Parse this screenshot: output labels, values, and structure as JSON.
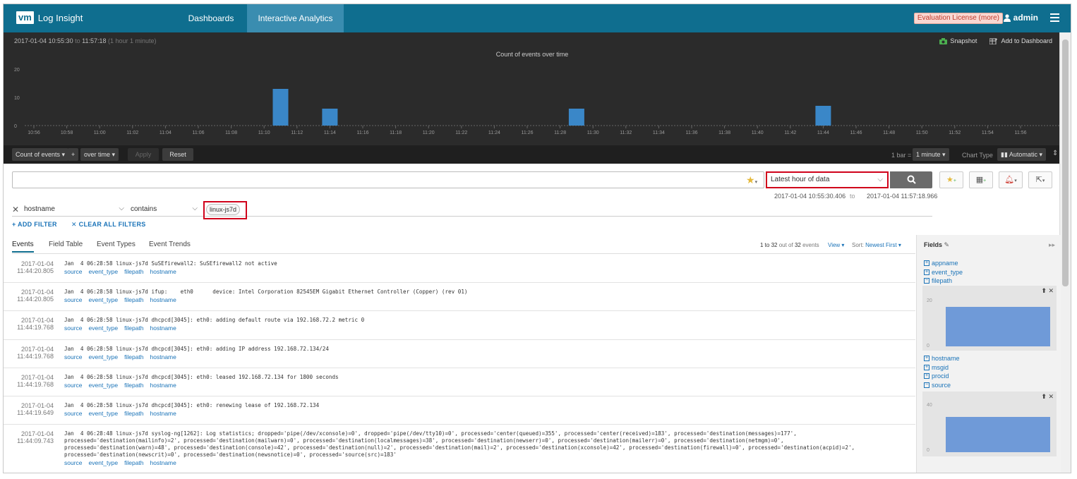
{
  "app": {
    "logo": "vm",
    "title": "Log Insight"
  },
  "nav": {
    "tabs": [
      {
        "label": "Dashboards"
      },
      {
        "label": "Interactive Analytics"
      }
    ]
  },
  "header": {
    "license": "Evaluation License (more)",
    "user": "admin"
  },
  "chart_panel": {
    "range_start": "2017-01-04  10:55:30",
    "range_to": "to",
    "range_end": "11:57:18",
    "range_duration": "(1 hour 1 minute)",
    "snapshot": "Snapshot",
    "add_to_dashboard": "Add to Dashboard"
  },
  "chart_data": {
    "type": "bar",
    "title": "Count of events over time",
    "x_ticks": [
      "10:56",
      "10:58",
      "11:00",
      "11:02",
      "11:04",
      "11:06",
      "11:08",
      "11:10",
      "11:12",
      "11:14",
      "11:16",
      "11:18",
      "11:20",
      "11:22",
      "11:24",
      "11:26",
      "11:28",
      "11:30",
      "11:32",
      "11:34",
      "11:36",
      "11:38",
      "11:40",
      "11:42",
      "11:44",
      "11:46",
      "11:48",
      "11:50",
      "11:52",
      "11:54",
      "11:56"
    ],
    "y_ticks": [
      0,
      10,
      20
    ],
    "ylim": [
      0,
      20
    ],
    "bars": [
      {
        "x": "11:11",
        "value": 13
      },
      {
        "x": "11:14",
        "value": 6
      },
      {
        "x": "11:29",
        "value": 6
      },
      {
        "x": "11:44",
        "value": 7
      }
    ],
    "color": "#3a87c8"
  },
  "chart_toolbar": {
    "metric": "Count of events",
    "plus": "+",
    "group": "over time",
    "apply": "Apply",
    "reset": "Reset",
    "bar_label": "1 bar =",
    "bar_value": "1 minute",
    "chart_type_label": "Chart Type",
    "chart_type_value": "Automatic"
  },
  "search": {
    "query": "",
    "time_range": "Latest hour of data",
    "range_start": "2017-01-04 10:55:30.406",
    "range_to": "to",
    "range_end": "2017-01-04 11:57:18.966"
  },
  "filter": {
    "field": "hostname",
    "operator": "contains",
    "value": "linux-js7d",
    "add_filter": "+ ADD FILTER",
    "clear_filters": "✕ CLEAR ALL FILTERS"
  },
  "tabs": [
    {
      "label": "Events"
    },
    {
      "label": "Field Table"
    },
    {
      "label": "Event Types"
    },
    {
      "label": "Event Trends"
    }
  ],
  "results": {
    "range": "1 to 32",
    "out_of": "out of",
    "total": "32",
    "events_word": "events",
    "view": "View ▾",
    "sort_label": "Sort:",
    "sort_value": "Newest First ▾"
  },
  "tag_labels": [
    "source",
    "event_type",
    "filepath",
    "hostname"
  ],
  "events": [
    {
      "date": "2017-01-04",
      "time": "11:44:20.805",
      "message": "Jan  4 06:28:58 linux-js7d SuSEfirewall2: SuSEfirewall2 not active"
    },
    {
      "date": "2017-01-04",
      "time": "11:44:20.805",
      "message": "Jan  4 06:28:58 linux-js7d ifup:    eth0      device: Intel Corporation 82545EM Gigabit Ethernet Controller (Copper) (rev 01)"
    },
    {
      "date": "2017-01-04",
      "time": "11:44:19.768",
      "message": "Jan  4 06:28:58 linux-js7d dhcpcd[3045]: eth0: adding default route via 192.168.72.2 metric 0"
    },
    {
      "date": "2017-01-04",
      "time": "11:44:19.768",
      "message": "Jan  4 06:28:58 linux-js7d dhcpcd[3045]: eth0: adding IP address 192.168.72.134/24"
    },
    {
      "date": "2017-01-04",
      "time": "11:44:19.768",
      "message": "Jan  4 06:28:58 linux-js7d dhcpcd[3045]: eth0: leased 192.168.72.134 for 1800 seconds"
    },
    {
      "date": "2017-01-04",
      "time": "11:44:19.649",
      "message": "Jan  4 06:28:58 linux-js7d dhcpcd[3045]: eth0: renewing lease of 192.168.72.134"
    },
    {
      "date": "2017-01-04",
      "time": "11:44:09.743",
      "message": "Jan  4 06:28:48 linux-js7d syslog-ng[1262]: Log statistics; dropped='pipe(/dev/xconsole)=0', dropped='pipe(/dev/tty10)=0', processed='center(queued)=355', processed='center(received)=183', processed='destination(messages)=177',\nprocessed='destination(mailinfo)=2', processed='destination(mailwarn)=0', processed='destination(localmessages)=38', processed='destination(newserr)=0', processed='destination(mailerr)=0', processed='destination(netmgm)=0',\nprocessed='destination(warn)=48', processed='destination(console)=42', processed='destination(null)=2', processed='destination(mail)=2', processed='destination(xconsole)=42', processed='destination(firewall)=0', processed='destination(acpid)=2',\nprocessed='destination(newscrit)=0', processed='destination(newsnotice)=0', processed='source(src)=183'"
    }
  ],
  "fields_panel": {
    "title": "Fields",
    "items_top": [
      "appname",
      "event_type",
      "filepath"
    ],
    "items_bottom": [
      "hostname",
      "msgid",
      "procid",
      "source"
    ],
    "chart1": {
      "y_ticks": [
        "20",
        "0"
      ],
      "value": 18,
      "ymax": 20
    },
    "chart2": {
      "y_ticks": [
        "40",
        "0"
      ],
      "value": 32,
      "ymax": 40
    }
  }
}
